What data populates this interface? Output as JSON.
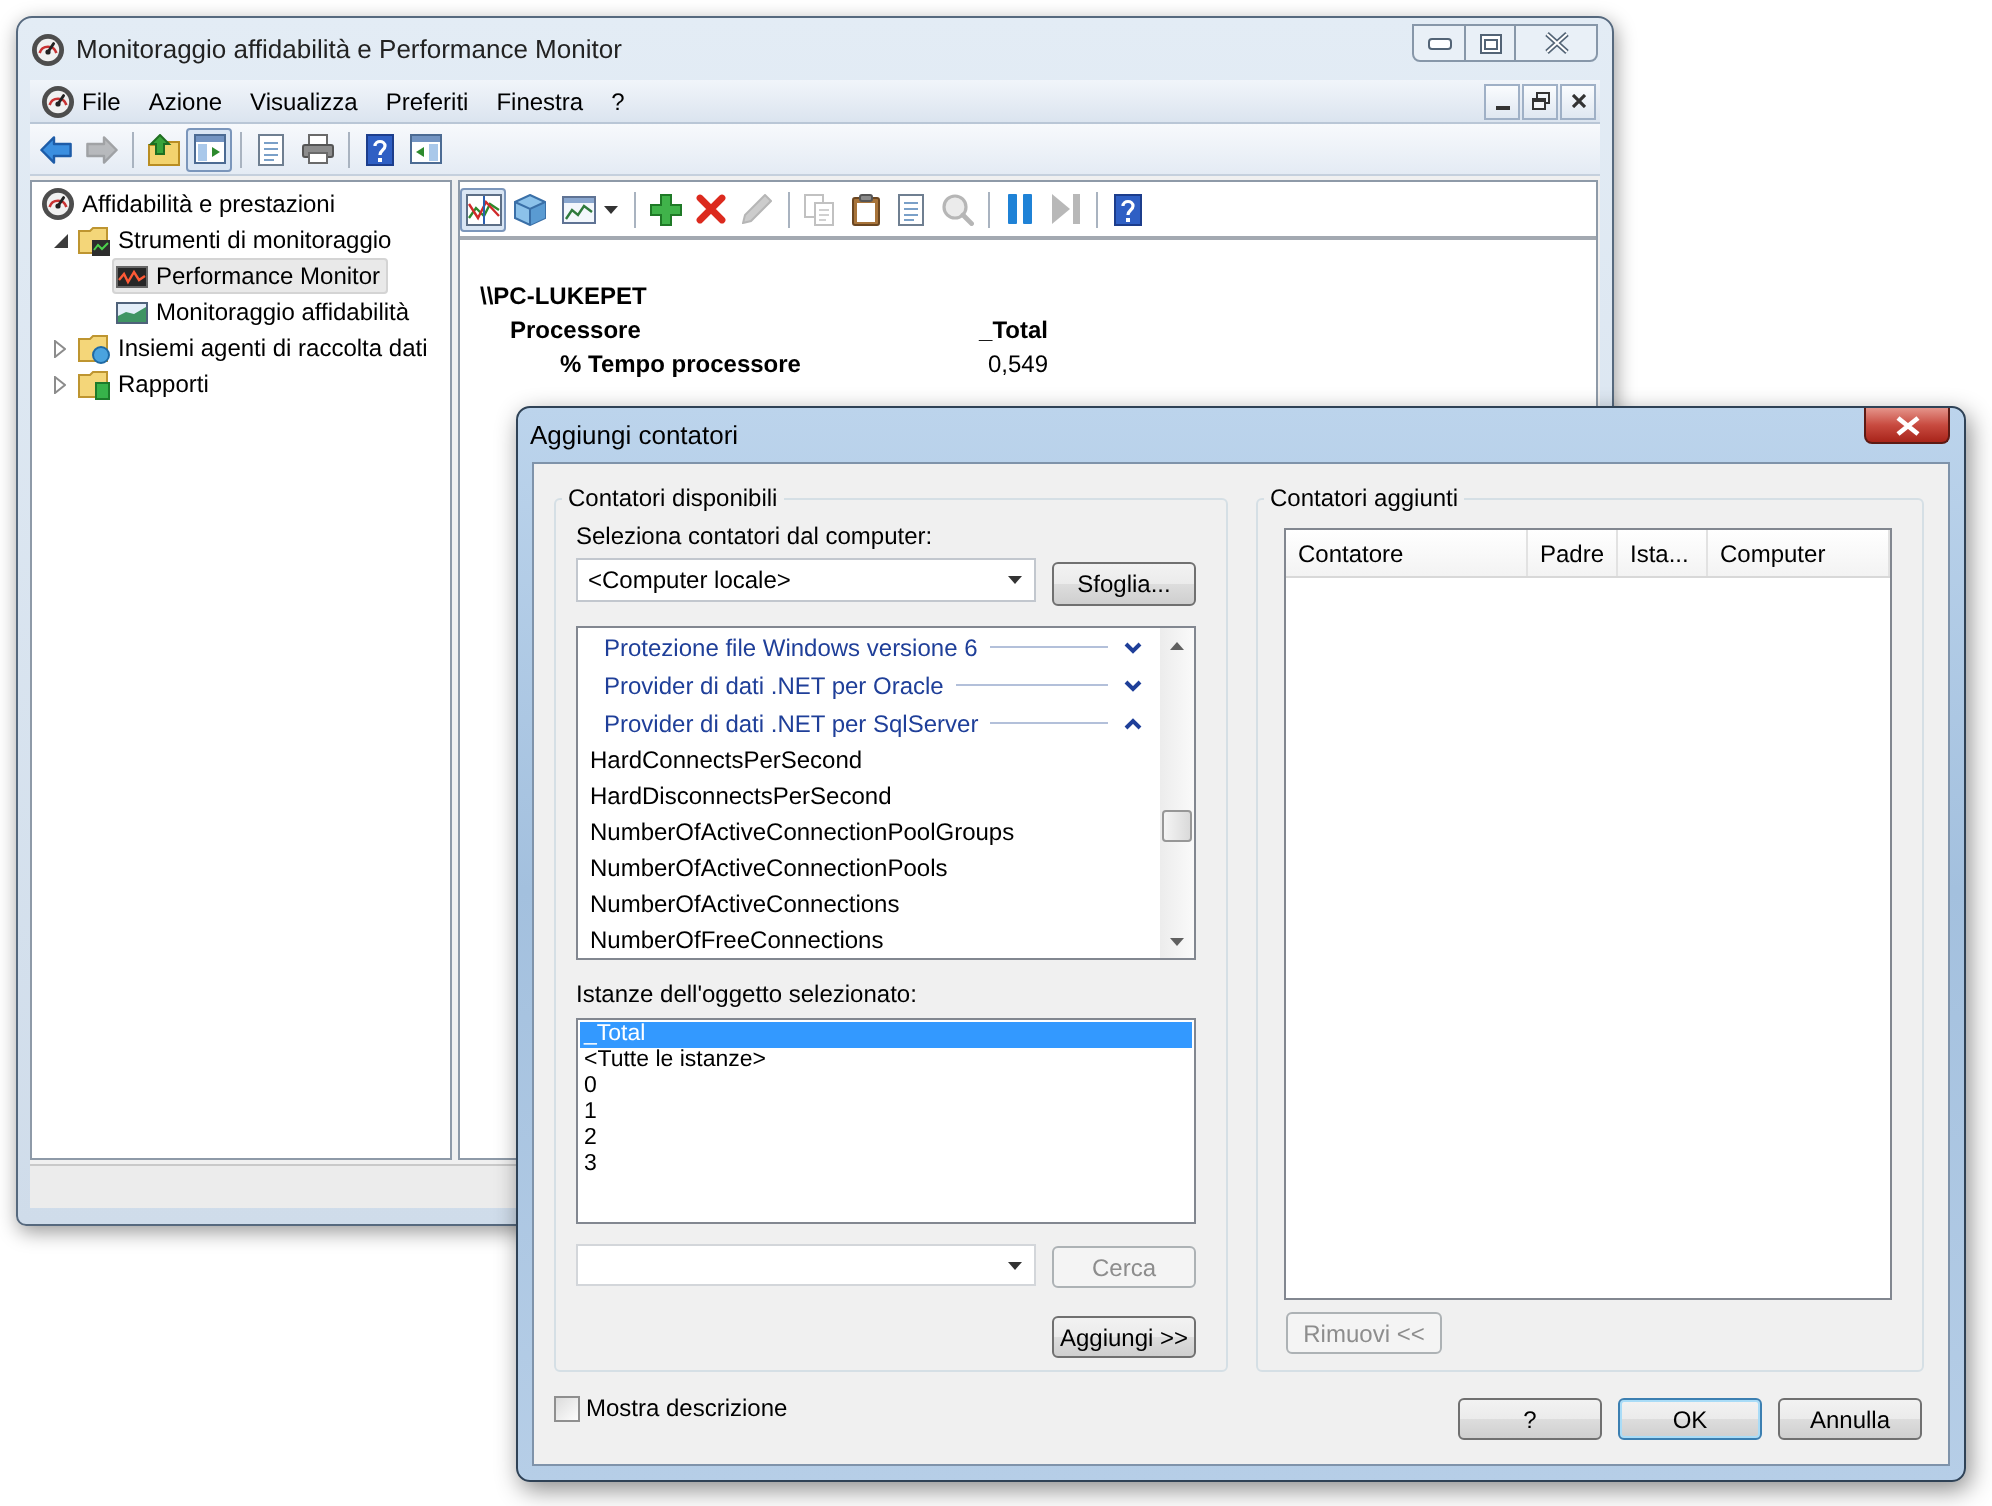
{
  "main_window": {
    "title": "Monitoraggio affidabilità e Performance Monitor"
  },
  "menu": [
    "File",
    "Azione",
    "Visualizza",
    "Preferiti",
    "Finestra",
    "?"
  ],
  "main_toolbar": [
    {
      "kind": "back",
      "pressed": false,
      "disabled": false
    },
    {
      "kind": "forward",
      "pressed": false,
      "disabled": true
    },
    {
      "kind": "separator"
    },
    {
      "kind": "up",
      "pressed": false,
      "disabled": false
    },
    {
      "kind": "tree",
      "pressed": true,
      "disabled": false
    },
    {
      "kind": "separator"
    },
    {
      "kind": "properties",
      "pressed": false,
      "disabled": false
    },
    {
      "kind": "print",
      "pressed": false,
      "disabled": false
    },
    {
      "kind": "separator"
    },
    {
      "kind": "help",
      "pressed": false,
      "disabled": false
    },
    {
      "kind": "actions",
      "pressed": false,
      "disabled": false
    }
  ],
  "tree": [
    {
      "label": "Affidabilità e prestazioni",
      "kind": "gauge",
      "selected": false,
      "children": [
        {
          "label": "Strumenti di monitoraggio",
          "kind": "tools",
          "expanded": true,
          "selected": false,
          "children": [
            {
              "label": "Performance Monitor",
              "kind": "monitor",
              "selected": true
            },
            {
              "label": "Monitoraggio affidabilità",
              "kind": "reliability",
              "selected": false
            }
          ]
        },
        {
          "label": "Insiemi agenti di raccolta dati",
          "kind": "collectors",
          "expanded": false,
          "selected": false
        },
        {
          "label": "Rapporti",
          "kind": "reports",
          "expanded": false,
          "selected": false
        }
      ]
    }
  ],
  "report_toolbar": [
    {
      "kind": "graph",
      "pressed": true,
      "disabled": false
    },
    {
      "kind": "freeze",
      "pressed": false,
      "disabled": false
    },
    {
      "kind": "chart",
      "pressed": false,
      "disabled": false
    },
    {
      "kind": "separator"
    },
    {
      "kind": "add",
      "pressed": false,
      "disabled": false
    },
    {
      "kind": "delete",
      "pressed": false,
      "disabled": false
    },
    {
      "kind": "edit",
      "pressed": false,
      "disabled": true
    },
    {
      "kind": "separator"
    },
    {
      "kind": "copy",
      "pressed": false,
      "disabled": true
    },
    {
      "kind": "paste",
      "pressed": false,
      "disabled": false
    },
    {
      "kind": "properties",
      "pressed": false,
      "disabled": false
    },
    {
      "kind": "zoom",
      "pressed": false,
      "disabled": true
    },
    {
      "kind": "separator"
    },
    {
      "kind": "pause",
      "pressed": false,
      "disabled": false
    },
    {
      "kind": "step",
      "pressed": false,
      "disabled": true
    },
    {
      "kind": "separator"
    },
    {
      "kind": "help",
      "pressed": false,
      "disabled": false
    }
  ],
  "report": {
    "computer": "\\\\PC-LUKEPET",
    "object": "Processore",
    "instance": "_Total",
    "counters": [
      {
        "name": "% Tempo processore",
        "value": "0,549"
      }
    ]
  },
  "dialog": {
    "title": "Aggiungi contatori",
    "available": {
      "legend": "Contatori disponibili",
      "computer_label": "Seleziona contatori dal computer:",
      "computer_select": {
        "value": "<Computer locale>"
      },
      "browse_button": {
        "label": "Sfoglia...",
        "disabled": false
      },
      "counter_groups": [
        {
          "label": "Protezione file Windows versione 6",
          "expanded": false
        },
        {
          "label": "Provider di dati .NET per Oracle",
          "expanded": false
        },
        {
          "label": "Provider di dati .NET per SqlServer",
          "expanded": true,
          "children": [
            {
              "label": "HardConnectsPerSecond",
              "selected": false
            },
            {
              "label": "HardDisconnectsPerSecond",
              "selected": false
            },
            {
              "label": "NumberOfActiveConnectionPoolGroups",
              "selected": false
            },
            {
              "label": "NumberOfActiveConnectionPools",
              "selected": false
            },
            {
              "label": "NumberOfActiveConnections",
              "selected": false
            },
            {
              "label": "NumberOfFreeConnections",
              "selected": false
            }
          ]
        }
      ],
      "instances_label": "Istanze dell'oggetto selezionato:",
      "instances": [
        {
          "label": "_Total",
          "selected": true
        },
        {
          "label": "<Tutte le istanze>",
          "selected": false
        },
        {
          "label": "0",
          "selected": false
        },
        {
          "label": "1",
          "selected": false
        },
        {
          "label": "2",
          "selected": false
        },
        {
          "label": "3",
          "selected": false
        }
      ],
      "search_button": {
        "label": "Cerca",
        "disabled": true
      },
      "add_button": {
        "label": "Aggiungi >>",
        "disabled": false
      }
    },
    "added": {
      "legend": "Contatori aggiunti",
      "columns": [
        "Contatore",
        "Padre",
        "Ista...",
        "Computer"
      ],
      "remove_button": {
        "label": "Rimuovi <<",
        "disabled": true
      }
    },
    "show_description": {
      "label": "Mostra descrizione",
      "checked": false
    },
    "buttons": [
      {
        "label": "?",
        "default": false
      },
      {
        "label": "OK",
        "default": true
      },
      {
        "label": "Annulla",
        "default": false
      }
    ]
  }
}
